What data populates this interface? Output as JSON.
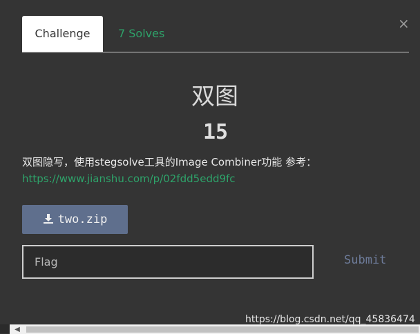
{
  "tabs": {
    "challenge_label": "Challenge",
    "solves_label": "7 Solves"
  },
  "close_glyph": "×",
  "challenge": {
    "title": "双图",
    "points": "15",
    "description": "双图隐写，使用stegsolve工具的Image Combiner功能 参考：",
    "reference_link": "https://www.jianshu.com/p/02fdd5edd9fc"
  },
  "file": {
    "label": "two.zip",
    "icon": "download-icon"
  },
  "flag": {
    "placeholder": "Flag",
    "value": ""
  },
  "submit_label": "Submit",
  "watermark": "https://blog.csdn.net/qq_45836474",
  "colors": {
    "background": "#343434",
    "accent_green": "#2ea36a",
    "file_button": "#5f6f8d",
    "submit_text": "#6d7b99"
  }
}
